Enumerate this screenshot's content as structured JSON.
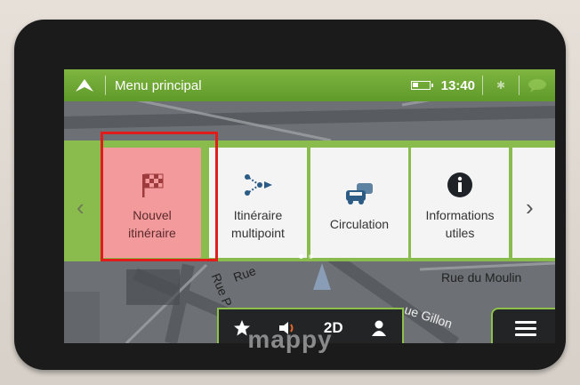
{
  "topbar": {
    "title": "Menu principal",
    "time": "13:40",
    "bluetooth_symbol": "✱",
    "icons": [
      "up-arrow-icon",
      "battery-icon",
      "bluetooth-icon",
      "message-icon"
    ]
  },
  "menu": {
    "tiles": [
      {
        "label_line1": "Nouvel",
        "label_line2": "itinéraire",
        "icon": "checkered-flag-icon",
        "selected": true
      },
      {
        "label_line1": "Itinéraire",
        "label_line2": "multipoint",
        "icon": "multipoint-route-icon",
        "selected": false
      },
      {
        "label_line1": "Circulation",
        "label_line2": "",
        "icon": "traffic-cars-icon",
        "selected": false
      },
      {
        "label_line1": "Informations",
        "label_line2": "utiles",
        "icon": "info-icon",
        "selected": false
      }
    ],
    "page_indicator": {
      "pages": 2,
      "current": 1
    }
  },
  "map": {
    "streets": [
      "Rue du Moulin",
      "Rue",
      "Rue P",
      "ue Gillon"
    ]
  },
  "toolbar": {
    "view_mode": "2D",
    "icons": [
      "favorite-star-icon",
      "volume-icon",
      "view-mode-toggle",
      "user-profile-icon",
      "hamburger-menu-icon"
    ]
  },
  "device": {
    "brand": "mappy"
  },
  "colors": {
    "accent_green": "#7fb540",
    "selected_tile": "#f39a9c",
    "highlight_outline": "#e21b1b",
    "toolbar_dark": "#222426"
  }
}
